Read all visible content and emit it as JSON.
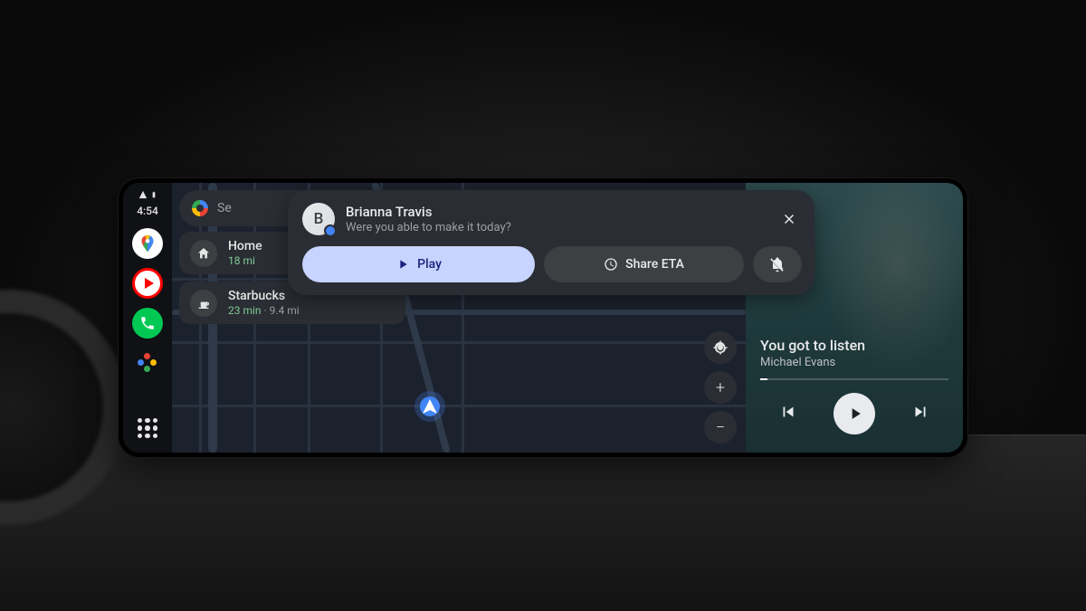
{
  "status": {
    "time": "4:54"
  },
  "search": {
    "placeholder": "Se"
  },
  "suggestions": [
    {
      "title": "Home",
      "eta": "18 mi",
      "extra": ""
    },
    {
      "title": "Starbucks",
      "eta": "23 min",
      "extra": "9.4 mi"
    }
  ],
  "notification": {
    "avatar_initial": "B",
    "sender": "Brianna Travis",
    "message": "Were you able to make it today?",
    "actions": {
      "play": "Play",
      "share_eta": "Share ETA"
    }
  },
  "media": {
    "track": "You got to listen",
    "artist": "Michael Evans"
  }
}
